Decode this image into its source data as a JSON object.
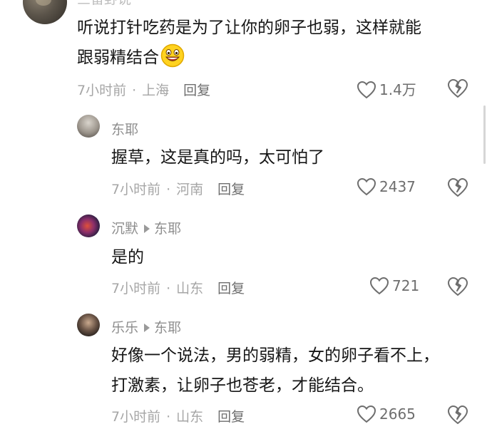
{
  "top_comment": {
    "author": "三留野说",
    "text_line1": "听说打针吃药是为了让你的卵子也弱，这样就能",
    "text_line2": "跟弱精结合",
    "time": "7小时前",
    "location": "上海",
    "reply_label": "回复",
    "likes": "1.4万"
  },
  "replies": [
    {
      "author": "东耶",
      "reply_to": "",
      "text_line1": "握草，这是真的吗，太可怕了",
      "text_line2": "",
      "time": "7小时前",
      "location": "河南",
      "reply_label": "回复",
      "likes": "2437"
    },
    {
      "author": "沉默",
      "reply_to": "东耶",
      "text_line1": "是的",
      "text_line2": "",
      "time": "7小时前",
      "location": "山东",
      "reply_label": "回复",
      "likes": "721"
    },
    {
      "author": "乐乐",
      "reply_to": "东耶",
      "text_line1": "好像一个说法，男的弱精，女的卵子看不上，",
      "text_line2": "打激素，让卵子也苍老，才能结合。",
      "time": "7小时前",
      "location": "山东",
      "reply_label": "回复",
      "likes": "2665"
    }
  ],
  "separator": "·",
  "icons": {
    "like": "heart-outline-icon",
    "dislike": "broken-heart-icon",
    "emoji": "grinning-emoji-icon",
    "reply_arrow": "play-arrow-icon"
  },
  "colors": {
    "text": "#161616",
    "meta": "#a6a6a6",
    "icon": "#6e6e6e"
  }
}
